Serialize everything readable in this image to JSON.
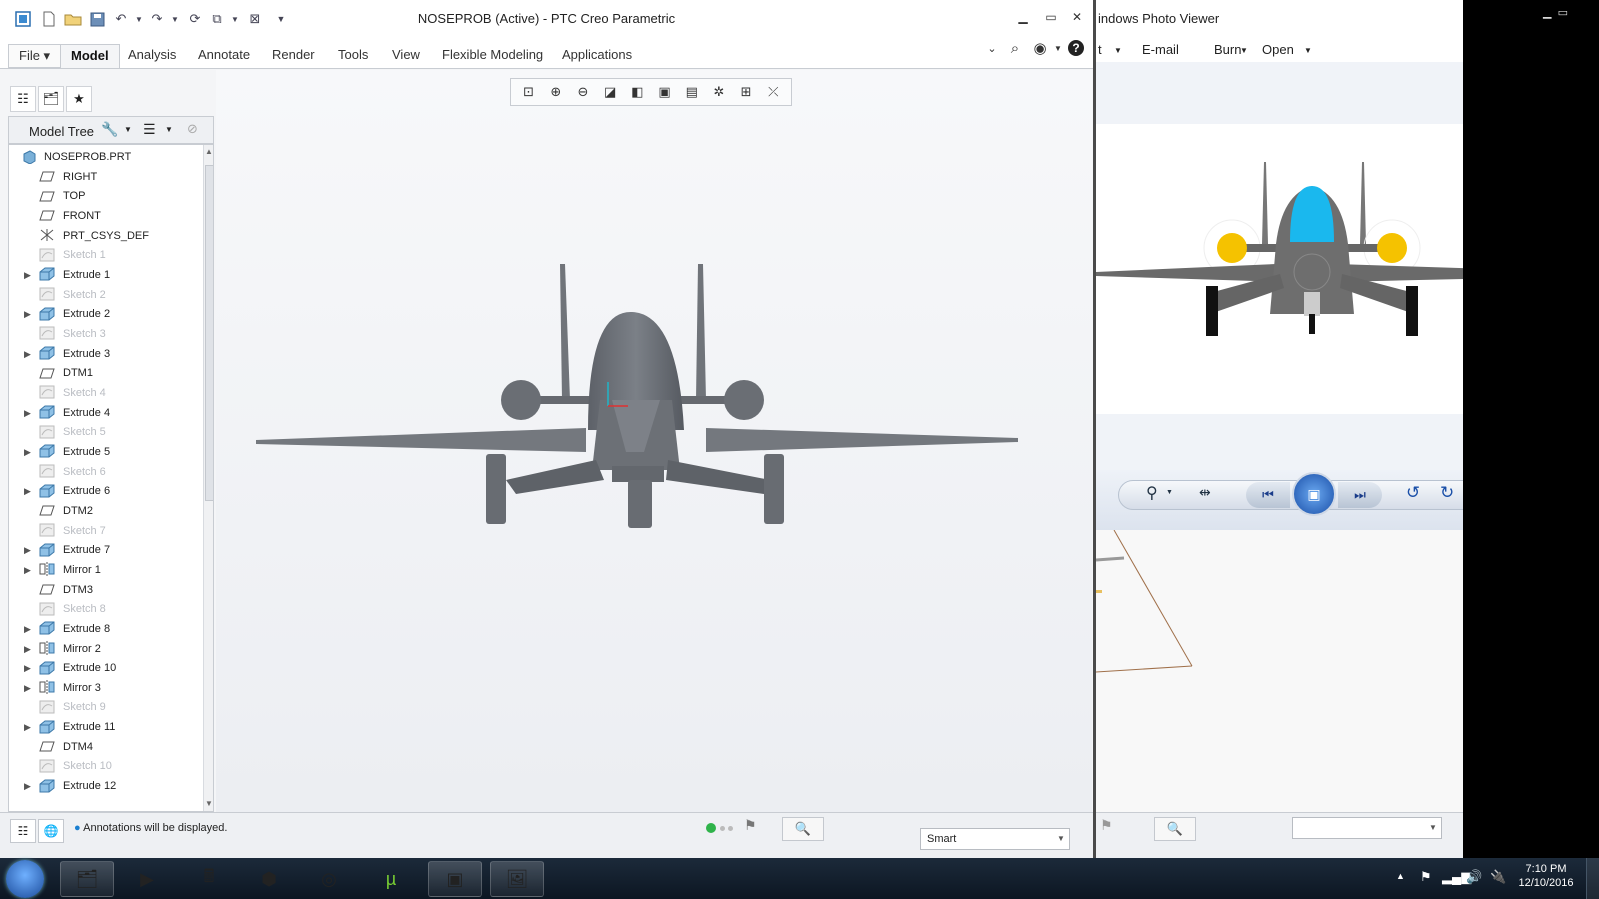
{
  "creo": {
    "title": "NOSEPROB (Active) - PTC Creo Parametric",
    "ribbon_tabs": [
      "File ▾",
      "Model",
      "Analysis",
      "Annotate",
      "Render",
      "Tools",
      "View",
      "Flexible Modeling",
      "Applications"
    ],
    "active_tab": "Model",
    "tree_label": "Model Tree",
    "tree_items": [
      {
        "label": "NOSEPROB.PRT",
        "type": "part",
        "expandable": false,
        "dim": false
      },
      {
        "label": "RIGHT",
        "type": "plane",
        "expandable": false,
        "dim": false
      },
      {
        "label": "TOP",
        "type": "plane",
        "expandable": false,
        "dim": false
      },
      {
        "label": "FRONT",
        "type": "plane",
        "expandable": false,
        "dim": false
      },
      {
        "label": "PRT_CSYS_DEF",
        "type": "csys",
        "expandable": false,
        "dim": false
      },
      {
        "label": "Sketch 1",
        "type": "sketch",
        "expandable": false,
        "dim": true
      },
      {
        "label": "Extrude 1",
        "type": "extrude",
        "expandable": true,
        "dim": false
      },
      {
        "label": "Sketch 2",
        "type": "sketch",
        "expandable": false,
        "dim": true
      },
      {
        "label": "Extrude 2",
        "type": "extrude",
        "expandable": true,
        "dim": false
      },
      {
        "label": "Sketch 3",
        "type": "sketch",
        "expandable": false,
        "dim": true
      },
      {
        "label": "Extrude 3",
        "type": "extrude",
        "expandable": true,
        "dim": false
      },
      {
        "label": "DTM1",
        "type": "plane",
        "expandable": false,
        "dim": false
      },
      {
        "label": "Sketch 4",
        "type": "sketch",
        "expandable": false,
        "dim": true
      },
      {
        "label": "Extrude 4",
        "type": "extrude",
        "expandable": true,
        "dim": false
      },
      {
        "label": "Sketch 5",
        "type": "sketch",
        "expandable": false,
        "dim": true
      },
      {
        "label": "Extrude 5",
        "type": "extrude",
        "expandable": true,
        "dim": false
      },
      {
        "label": "Sketch 6",
        "type": "sketch",
        "expandable": false,
        "dim": true
      },
      {
        "label": "Extrude 6",
        "type": "extrude",
        "expandable": true,
        "dim": false
      },
      {
        "label": "DTM2",
        "type": "plane",
        "expandable": false,
        "dim": false
      },
      {
        "label": "Sketch 7",
        "type": "sketch",
        "expandable": false,
        "dim": true
      },
      {
        "label": "Extrude 7",
        "type": "extrude",
        "expandable": true,
        "dim": false
      },
      {
        "label": "Mirror 1",
        "type": "mirror",
        "expandable": true,
        "dim": false
      },
      {
        "label": "DTM3",
        "type": "plane",
        "expandable": false,
        "dim": false
      },
      {
        "label": "Sketch 8",
        "type": "sketch",
        "expandable": false,
        "dim": true
      },
      {
        "label": "Extrude 8",
        "type": "extrude",
        "expandable": true,
        "dim": false
      },
      {
        "label": "Mirror 2",
        "type": "mirror",
        "expandable": true,
        "dim": false
      },
      {
        "label": "Extrude 10",
        "type": "extrude",
        "expandable": true,
        "dim": false
      },
      {
        "label": "Mirror 3",
        "type": "mirror",
        "expandable": true,
        "dim": false
      },
      {
        "label": "Sketch 9",
        "type": "sketch",
        "expandable": false,
        "dim": true
      },
      {
        "label": "Extrude 11",
        "type": "extrude",
        "expandable": true,
        "dim": false
      },
      {
        "label": "DTM4",
        "type": "plane",
        "expandable": false,
        "dim": false
      },
      {
        "label": "Sketch 10",
        "type": "sketch",
        "expandable": false,
        "dim": true
      },
      {
        "label": "Extrude 12",
        "type": "extrude",
        "expandable": true,
        "dim": false
      }
    ],
    "status_message": "Annotations will be displayed.",
    "filter_value": "Smart"
  },
  "photo_viewer": {
    "title": "indows Photo Viewer",
    "menu": [
      "t",
      "E-mail",
      "Burn",
      "Open"
    ]
  },
  "taskbar": {
    "time": "7:10 PM",
    "date": "12/10/2016"
  },
  "colors": {
    "model_gray": "#6e7278",
    "canopy_blue": "#1ab8ee",
    "engine_yellow": "#f5c200"
  }
}
